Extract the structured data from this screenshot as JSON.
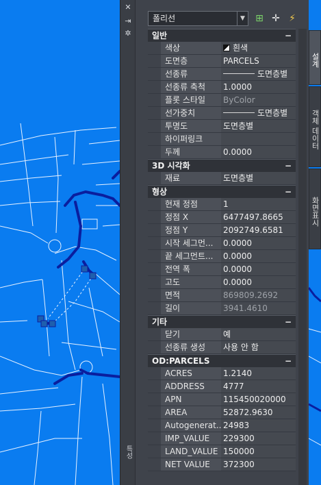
{
  "palette": {
    "title": "특성",
    "strip_icons": [
      "close-icon",
      "auto-hide-icon",
      "settings-icon"
    ],
    "selection": "폴리선",
    "toolbar": [
      "add-selection-icon",
      "pick-objects-icon",
      "quick-select-icon"
    ]
  },
  "sections": [
    {
      "title": "일반",
      "rows": [
        {
          "name": "색상",
          "value": "흰색",
          "swatch": true
        },
        {
          "name": "도면층",
          "value": "PARCELS"
        },
        {
          "name": "선종류",
          "value": "도면층별",
          "line": true
        },
        {
          "name": "선종류 축척",
          "value": "1.0000"
        },
        {
          "name": "플롯 스타일",
          "value": "ByColor",
          "dim": true
        },
        {
          "name": "선가중치",
          "value": "도면층별",
          "line": true
        },
        {
          "name": "투명도",
          "value": "도면층별"
        },
        {
          "name": "하이퍼링크",
          "value": ""
        },
        {
          "name": "두께",
          "value": "0.0000"
        }
      ]
    },
    {
      "title": "3D 시각화",
      "rows": [
        {
          "name": "재료",
          "value": "도면층별"
        }
      ]
    },
    {
      "title": "형상",
      "rows": [
        {
          "name": "현재 정점",
          "value": "1"
        },
        {
          "name": "정점 X",
          "value": "6477497.8665"
        },
        {
          "name": "정점 Y",
          "value": "2092749.6581"
        },
        {
          "name": "시작 세그먼...",
          "value": "0.0000"
        },
        {
          "name": "끝 세그먼트...",
          "value": "0.0000"
        },
        {
          "name": "전역 폭",
          "value": "0.0000"
        },
        {
          "name": "고도",
          "value": "0.0000"
        },
        {
          "name": "면적",
          "value": "869809.2692",
          "dim": true
        },
        {
          "name": "길이",
          "value": "3941.4610",
          "dim": true
        }
      ]
    },
    {
      "title": "기타",
      "rows": [
        {
          "name": "닫기",
          "value": "예"
        },
        {
          "name": "선종류 생성",
          "value": "사용 안 함"
        }
      ]
    },
    {
      "title": "OD:PARCELS",
      "rows": [
        {
          "name": "ACRES",
          "value": "1.2140"
        },
        {
          "name": "ADDRESS",
          "value": "4777"
        },
        {
          "name": "APN",
          "value": "115450020000"
        },
        {
          "name": "AREA",
          "value": "52872.9630"
        },
        {
          "name": "Autogenerat...",
          "value": "24983"
        },
        {
          "name": "IMP_VALUE",
          "value": "229300"
        },
        {
          "name": "LAND_VALUE",
          "value": "150000"
        },
        {
          "name": "NET VALUE",
          "value": "372300"
        }
      ]
    }
  ],
  "side_tabs": [
    "설계",
    "객체 데이터",
    "화면표시"
  ],
  "colors": {
    "map_background": "#0a7cf0",
    "road": "#0a1e9e",
    "parcel_lines": "#e9f2ff",
    "grip": "#1e5fae"
  }
}
